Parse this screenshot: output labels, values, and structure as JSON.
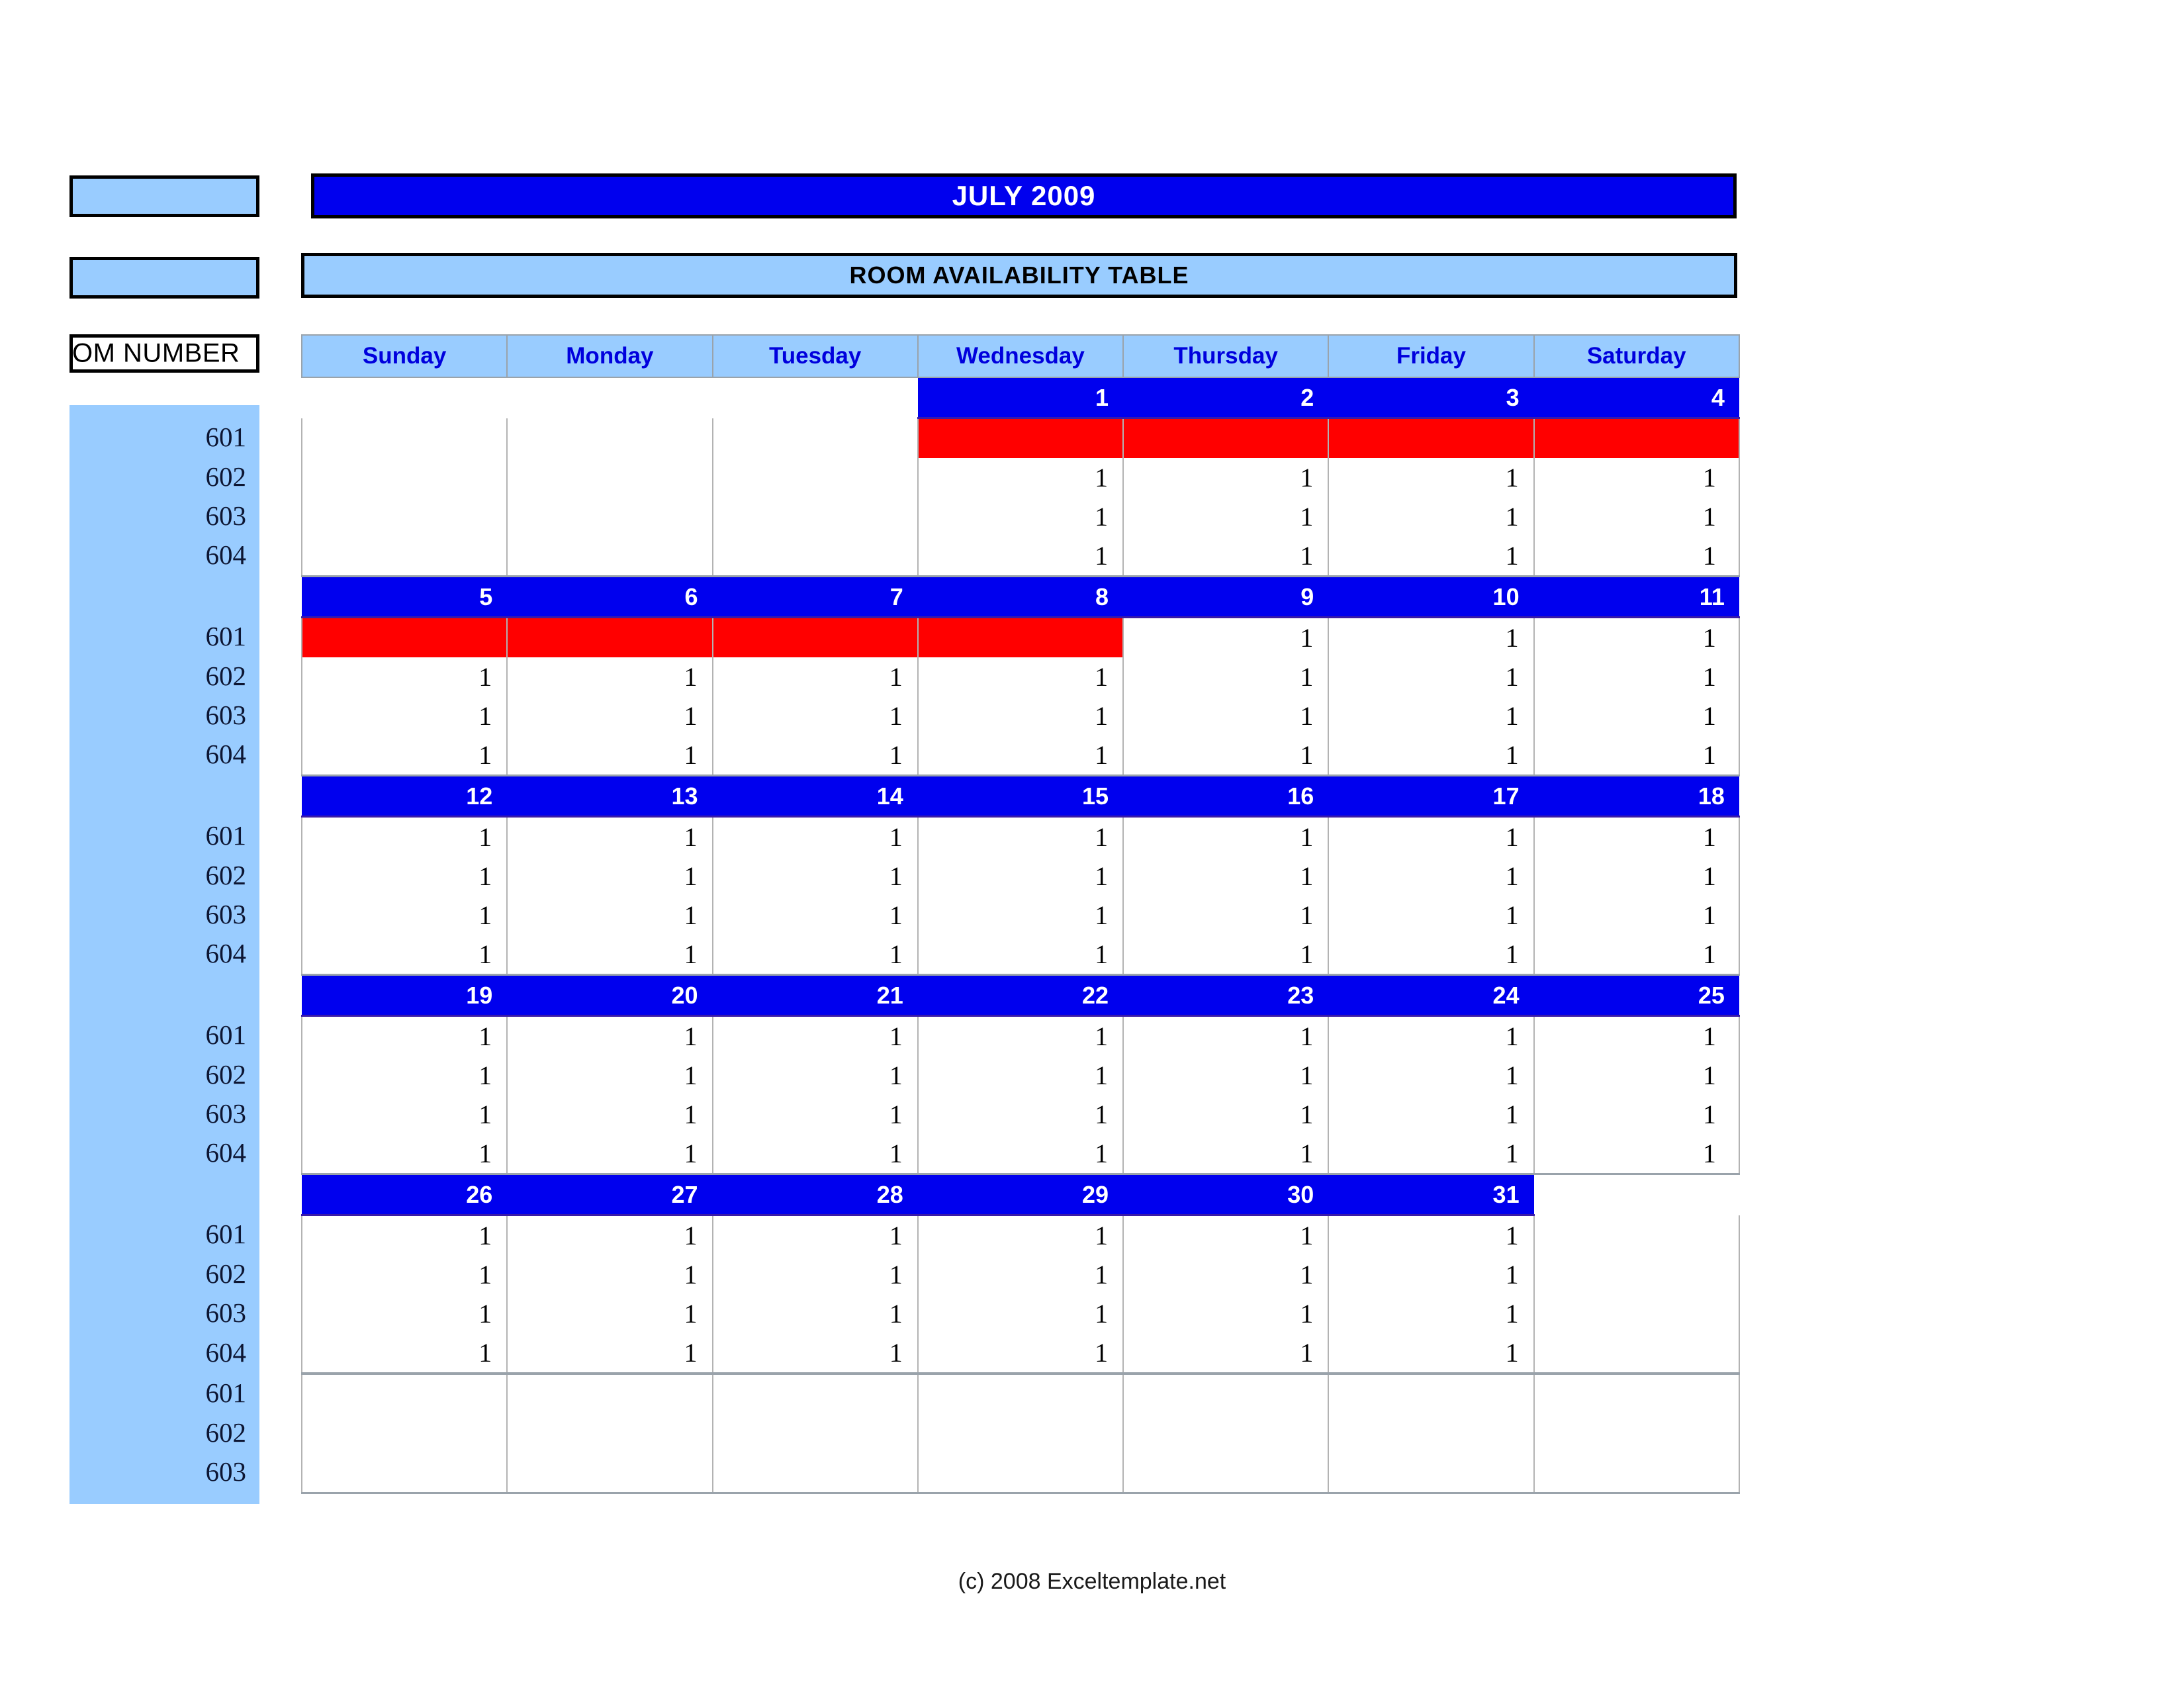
{
  "header": {
    "title": "JULY 2009",
    "subtitle": "ROOM AVAILABILITY TABLE"
  },
  "side_boxes": [
    {
      "name": "box-empty-1",
      "text": ""
    },
    {
      "name": "box-empty-2",
      "text": ""
    },
    {
      "name": "box-room-number",
      "text": "ROOM NUMBER"
    }
  ],
  "colors": {
    "title_blue": "#0000EE",
    "light_blue": "#99CCFF",
    "occupied_red": "#FF0000",
    "day_header_text": "#0000DD",
    "grid_line": "#B3B3B3"
  },
  "day_headers": [
    "Sunday",
    "Monday",
    "Tuesday",
    "Wednesday",
    "Thursday",
    "Friday",
    "Saturday"
  ],
  "rooms": [
    "601",
    "602",
    "603",
    "604"
  ],
  "footer": "(c) 2008 Exceltemplate.net",
  "chart_data": {
    "type": "table",
    "title": "JULY 2009 ROOM AVAILABILITY TABLE",
    "weeks": [
      {
        "dates": [
          "",
          "",
          "",
          "1",
          "2",
          "3",
          "4"
        ],
        "rows": [
          {
            "room": "601",
            "values": [
              "",
              "",
              "",
              "RED",
              "RED",
              "RED",
              "RED"
            ]
          },
          {
            "room": "602",
            "values": [
              "",
              "",
              "",
              "1",
              "1",
              "1",
              "1"
            ]
          },
          {
            "room": "603",
            "values": [
              "",
              "",
              "",
              "1",
              "1",
              "1",
              "1"
            ]
          },
          {
            "room": "604",
            "values": [
              "",
              "",
              "",
              "1",
              "1",
              "1",
              "1"
            ]
          }
        ]
      },
      {
        "dates": [
          "5",
          "6",
          "7",
          "8",
          "9",
          "10",
          "11"
        ],
        "rows": [
          {
            "room": "601",
            "values": [
              "RED",
              "RED",
              "RED",
              "RED",
              "1",
              "1",
              "1"
            ]
          },
          {
            "room": "602",
            "values": [
              "1",
              "1",
              "1",
              "1",
              "1",
              "1",
              "1"
            ]
          },
          {
            "room": "603",
            "values": [
              "1",
              "1",
              "1",
              "1",
              "1",
              "1",
              "1"
            ]
          },
          {
            "room": "604",
            "values": [
              "1",
              "1",
              "1",
              "1",
              "1",
              "1",
              "1"
            ]
          }
        ]
      },
      {
        "dates": [
          "12",
          "13",
          "14",
          "15",
          "16",
          "17",
          "18"
        ],
        "rows": [
          {
            "room": "601",
            "values": [
              "1",
              "1",
              "1",
              "1",
              "1",
              "1",
              "1"
            ]
          },
          {
            "room": "602",
            "values": [
              "1",
              "1",
              "1",
              "1",
              "1",
              "1",
              "1"
            ]
          },
          {
            "room": "603",
            "values": [
              "1",
              "1",
              "1",
              "1",
              "1",
              "1",
              "1"
            ]
          },
          {
            "room": "604",
            "values": [
              "1",
              "1",
              "1",
              "1",
              "1",
              "1",
              "1"
            ]
          }
        ]
      },
      {
        "dates": [
          "19",
          "20",
          "21",
          "22",
          "23",
          "24",
          "25"
        ],
        "rows": [
          {
            "room": "601",
            "values": [
              "1",
              "1",
              "1",
              "1",
              "1",
              "1",
              "1"
            ]
          },
          {
            "room": "602",
            "values": [
              "1",
              "1",
              "1",
              "1",
              "1",
              "1",
              "1"
            ]
          },
          {
            "room": "603",
            "values": [
              "1",
              "1",
              "1",
              "1",
              "1",
              "1",
              "1"
            ]
          },
          {
            "room": "604",
            "values": [
              "1",
              "1",
              "1",
              "1",
              "1",
              "1",
              "1"
            ]
          }
        ]
      },
      {
        "dates": [
          "26",
          "27",
          "28",
          "29",
          "30",
          "31",
          ""
        ],
        "rows": [
          {
            "room": "601",
            "values": [
              "1",
              "1",
              "1",
              "1",
              "1",
              "1",
              ""
            ]
          },
          {
            "room": "602",
            "values": [
              "1",
              "1",
              "1",
              "1",
              "1",
              "1",
              ""
            ]
          },
          {
            "room": "603",
            "values": [
              "1",
              "1",
              "1",
              "1",
              "1",
              "1",
              ""
            ]
          },
          {
            "room": "604",
            "values": [
              "1",
              "1",
              "1",
              "1",
              "1",
              "1",
              ""
            ]
          }
        ]
      },
      {
        "dates": [
          "",
          "",
          "",
          "",
          "",
          "",
          ""
        ],
        "rows": [
          {
            "room": "601",
            "values": [
              "",
              "",
              "",
              "",
              "",
              "",
              ""
            ]
          },
          {
            "room": "602",
            "values": [
              "",
              "",
              "",
              "",
              "",
              "",
              ""
            ]
          },
          {
            "room": "603",
            "values": [
              "",
              "",
              "",
              "",
              "",
              "",
              ""
            ]
          }
        ]
      }
    ]
  }
}
